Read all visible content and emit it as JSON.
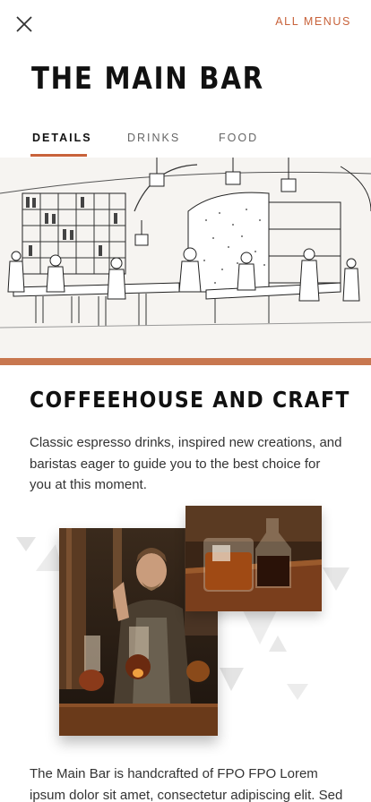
{
  "header": {
    "close_icon": "close-icon",
    "all_menus_label": "ALL MENUS"
  },
  "page": {
    "title": "THE MAIN BAR"
  },
  "tabs": [
    {
      "label": "DETAILS",
      "active": true
    },
    {
      "label": "DRINKS",
      "active": false
    },
    {
      "label": "FOOD",
      "active": false
    }
  ],
  "hero": {
    "image": "main-bar-sketch-illustration"
  },
  "section": {
    "heading": "COFFEEHOUSE AND CRAFT",
    "body": "Classic espresso drinks, inspired new creations, and baristas eager to guide you to the best choice for you at this moment."
  },
  "collage": {
    "photo_1": "bartender-photo",
    "photo_2": "drinks-photo"
  },
  "footer": {
    "text": "The Main Bar is handcrafted of FPO FPO Lorem ipsum dolor sit amet, consectetur adipiscing elit. Sed"
  },
  "colors": {
    "accent": "#c8623a",
    "stripe": "#c8774f",
    "text": "#333333"
  }
}
